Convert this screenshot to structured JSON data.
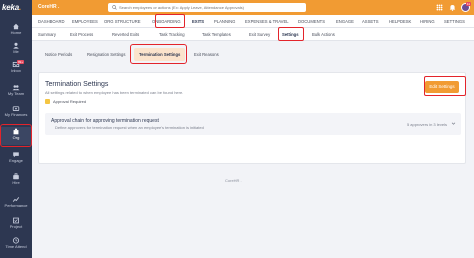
{
  "sidebar": {
    "logo": "keka",
    "items": [
      {
        "label": "Home",
        "icon": "home-icon"
      },
      {
        "label": "Me",
        "icon": "user-icon"
      },
      {
        "label": "Inbox",
        "icon": "inbox-icon",
        "badge": "99+"
      },
      {
        "label": "My Team",
        "icon": "team-icon"
      },
      {
        "label": "My Finances",
        "icon": "finances-icon"
      },
      {
        "label": "Org",
        "icon": "org-icon"
      },
      {
        "label": "Engage",
        "icon": "engage-icon"
      },
      {
        "label": "Hire",
        "icon": "hire-icon"
      },
      {
        "label": "Performance",
        "icon": "performance-icon"
      },
      {
        "label": "Project",
        "icon": "project-icon"
      },
      {
        "label": "Time Attend",
        "icon": "clock-icon"
      }
    ]
  },
  "topbar": {
    "company": "CoreHR .",
    "search_placeholder": "Search employees or actions (Ex: Apply Leave, Attendance Approvals)",
    "avatar_badge": "11"
  },
  "main_nav": {
    "items": [
      "DASHBOARD",
      "EMPLOYEES",
      "ORG STRUCTURE",
      "ONBOARDING",
      "EXITS",
      "PLANNING",
      "EXPENSES & TRAVEL",
      "DOCUMENTS",
      "ENGAGE",
      "ASSETS",
      "HELPDESK",
      "HIRING",
      "SETTINGS"
    ],
    "active": "EXITS"
  },
  "sub_nav": {
    "items": [
      "Summary",
      "Exit Process",
      "Reverted Exits",
      "Task Tracking",
      "Task Templates",
      "Exit Survey",
      "Settings",
      "Bulk Actions"
    ],
    "active": "Settings"
  },
  "tabs": {
    "items": [
      "Notice Periods",
      "Resignation Settings",
      "Termination Settings",
      "Exit Reasons"
    ],
    "active": "Termination Settings"
  },
  "card": {
    "title": "Termination Settings",
    "subtitle": "All settings related to when employee has been terminated can be found here.",
    "edit_label": "Edit Settings",
    "approval_label": "Approval Required",
    "approval_checked": true,
    "chain_title": "Approval chain for approving termination request",
    "chain_desc": "Define approvers for termination request when an employee's termination is initiated",
    "chain_count": "5 approvers in 3 levels"
  },
  "footer": "CoreHR .",
  "colors": {
    "sidebar_bg": "#2d3751",
    "accent": "#f19b33",
    "highlight": "#e3242b",
    "active_tab_bg": "#fbe3cc"
  }
}
